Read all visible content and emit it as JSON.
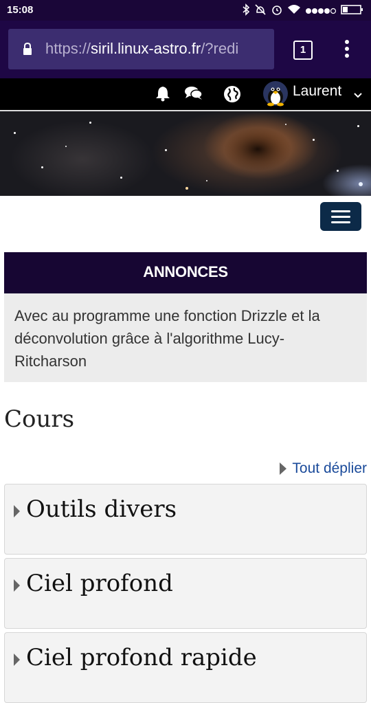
{
  "status_bar": {
    "time": "15:08",
    "icons": [
      "bluetooth-icon",
      "alarm-off-icon",
      "alarm-icon",
      "wifi-icon",
      "signal-icon",
      "battery-icon"
    ]
  },
  "browser": {
    "url_scheme": "https://",
    "url_host": "siril.linux-astro.fr",
    "url_rest": "/?redi",
    "tab_count": "1"
  },
  "navbar": {
    "username": "Laurent",
    "icons": [
      "bell-icon",
      "chat-icon",
      "globe-icon",
      "avatar-tux"
    ]
  },
  "announcements": {
    "heading": "ANNONCES",
    "text": "Avec au programme une fonction Drizzle et la déconvolution grâce à l'algorithme Lucy-Ritcharson"
  },
  "courses": {
    "heading": "Cours",
    "expand_all": "Tout déplier",
    "sections": [
      "Outils divers",
      "Ciel profond",
      "Ciel profond rapide"
    ]
  },
  "colors": {
    "status_bg": "#1a0638",
    "urlbar_bg": "#1e0745",
    "urlfield_bg": "#3c2d70",
    "navbar_bg": "#000000",
    "announcement_head_bg": "#170633",
    "announcement_body_bg": "#ececec",
    "menu_button_bg": "#0c2a48",
    "link_color": "#1a4a9a"
  }
}
